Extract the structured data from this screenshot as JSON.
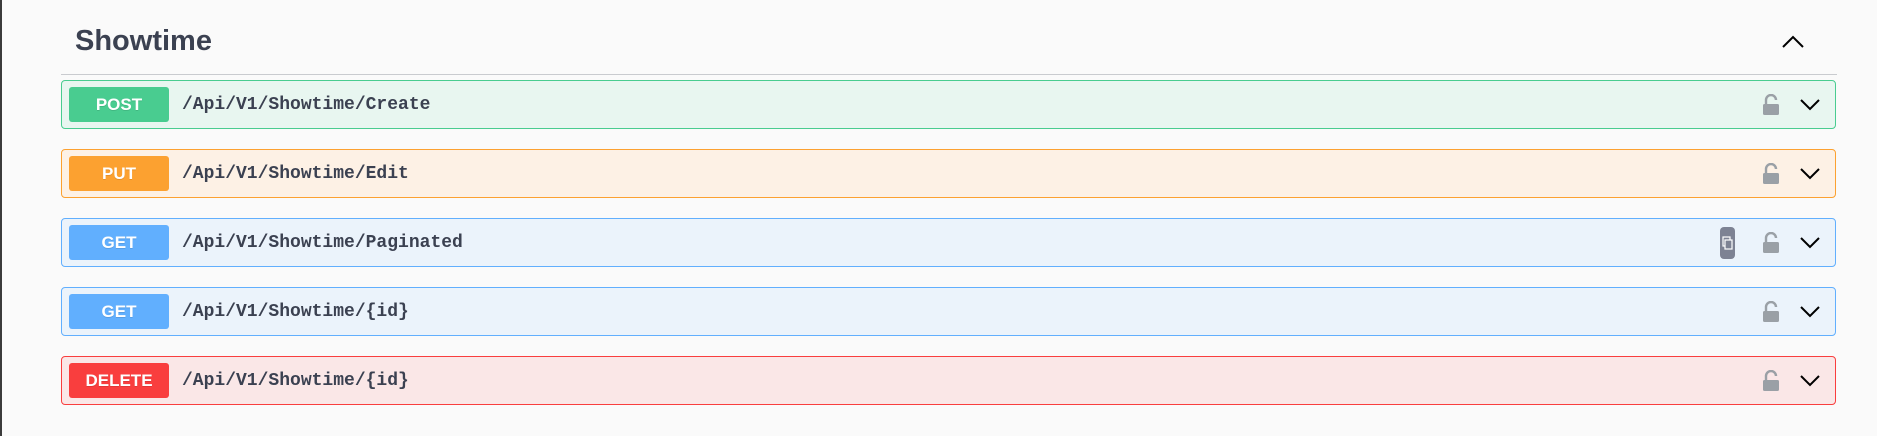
{
  "section": {
    "title": "Showtime"
  },
  "colors": {
    "post_bg": "#e8f6f0",
    "post_border": "#49cc90",
    "put_bg": "#fdf1e5",
    "put_border": "#fca130",
    "get_bg": "#ebf3fb",
    "get_border": "#61affe",
    "delete_bg": "#fae7e7",
    "delete_border": "#f93e3e"
  },
  "operations": [
    {
      "method": "POST",
      "path": "/Api/V1/Showtime/Create",
      "icons": [
        "lock-icon",
        "chevron-down-icon"
      ]
    },
    {
      "method": "PUT",
      "path": "/Api/V1/Showtime/Edit",
      "icons": [
        "lock-icon",
        "chevron-down-icon"
      ]
    },
    {
      "method": "GET",
      "path": "/Api/V1/Showtime/Paginated",
      "icons": [
        "copy-icon",
        "lock-icon",
        "chevron-down-icon"
      ]
    },
    {
      "method": "GET",
      "path": "/Api/V1/Showtime/{id}",
      "icons": [
        "lock-icon",
        "chevron-down-icon"
      ]
    },
    {
      "method": "DELETE",
      "path": "/Api/V1/Showtime/{id}",
      "icons": [
        "lock-icon",
        "chevron-down-icon"
      ]
    }
  ]
}
